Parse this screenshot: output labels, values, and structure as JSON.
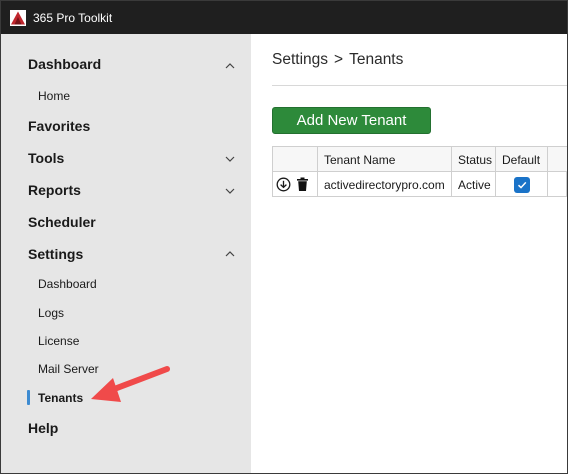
{
  "app": {
    "title": "365 Pro Toolkit",
    "logo_icon": "toolkit-logo-icon",
    "brand_color": "#c0262d"
  },
  "sidebar": {
    "sections": [
      {
        "label": "Dashboard",
        "expanded": true,
        "icon": "chevron-up-icon"
      },
      {
        "label": "Favorites"
      },
      {
        "label": "Tools",
        "expanded": false,
        "icon": "chevron-down-icon"
      },
      {
        "label": "Reports",
        "expanded": false,
        "icon": "chevron-down-icon"
      },
      {
        "label": "Scheduler"
      },
      {
        "label": "Settings",
        "expanded": true,
        "icon": "chevron-up-icon"
      },
      {
        "label": "Help"
      }
    ],
    "dashboard_items": [
      {
        "label": "Home"
      }
    ],
    "settings_items": [
      {
        "label": "Dashboard"
      },
      {
        "label": "Logs"
      },
      {
        "label": "License"
      },
      {
        "label": "Mail Server"
      },
      {
        "label": "Tenants",
        "active": true
      }
    ],
    "active_indicator_color": "#3d8bd1",
    "background": "#e6e6e6"
  },
  "main": {
    "breadcrumb": {
      "parent": "Settings",
      "separator": ">",
      "current": "Tenants"
    },
    "add_button_label": "Add New Tenant",
    "add_button_color": "#2d8a3a",
    "table": {
      "columns": [
        "",
        "Tenant Name",
        "Status",
        "Default"
      ],
      "rows": [
        {
          "actions": [
            "download-icon",
            "trash-icon"
          ],
          "tenant_name": "activedirectorypro.com",
          "status": "Active",
          "default": true
        }
      ]
    }
  },
  "annotation": {
    "arrow_color": "#f04a4a",
    "points_to": "Tenants"
  }
}
